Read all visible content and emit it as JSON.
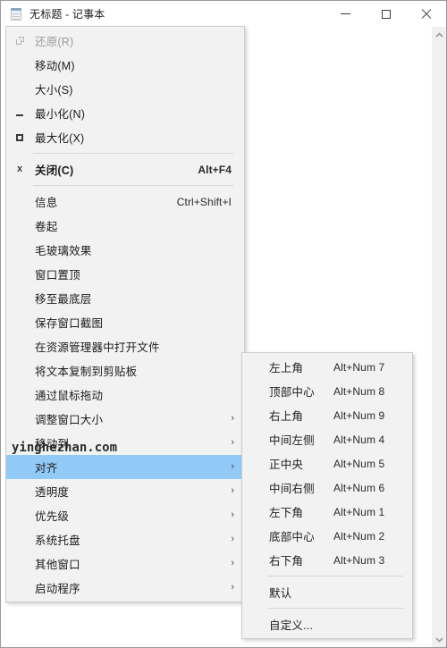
{
  "window": {
    "title": "无标题 - 记事本",
    "icon": "notepad-icon",
    "controls": {
      "minimize_label": "最小化",
      "maximize_label": "最大化",
      "close_label": "关闭"
    }
  },
  "system_menu": {
    "items": [
      {
        "label": "还原(R)",
        "accel": "",
        "icon": "restore-icon",
        "disabled": true,
        "bold": false,
        "submenu": false
      },
      {
        "label": "移动(M)",
        "accel": "",
        "icon": "",
        "disabled": false,
        "bold": false,
        "submenu": false
      },
      {
        "label": "大小(S)",
        "accel": "",
        "icon": "",
        "disabled": false,
        "bold": false,
        "submenu": false
      },
      {
        "label": "最小化(N)",
        "accel": "",
        "icon": "minimize-icon",
        "disabled": false,
        "bold": false,
        "submenu": false
      },
      {
        "label": "最大化(X)",
        "accel": "",
        "icon": "maximize-icon",
        "disabled": false,
        "bold": false,
        "submenu": false
      },
      {
        "separator": true
      },
      {
        "label": "关闭(C)",
        "accel": "Alt+F4",
        "icon": "close-icon",
        "disabled": false,
        "bold": true,
        "submenu": false
      },
      {
        "separator": true
      },
      {
        "label": "信息",
        "accel": "Ctrl+Shift+I",
        "icon": "",
        "disabled": false,
        "bold": false,
        "submenu": false
      },
      {
        "label": "卷起",
        "accel": "",
        "icon": "",
        "disabled": false,
        "bold": false,
        "submenu": false
      },
      {
        "label": "毛玻璃效果",
        "accel": "",
        "icon": "",
        "disabled": false,
        "bold": false,
        "submenu": false
      },
      {
        "label": "窗口置顶",
        "accel": "",
        "icon": "",
        "disabled": false,
        "bold": false,
        "submenu": false
      },
      {
        "label": "移至最底层",
        "accel": "",
        "icon": "",
        "disabled": false,
        "bold": false,
        "submenu": false
      },
      {
        "label": "保存窗口截图",
        "accel": "",
        "icon": "",
        "disabled": false,
        "bold": false,
        "submenu": false
      },
      {
        "label": "在资源管理器中打开文件",
        "accel": "",
        "icon": "",
        "disabled": false,
        "bold": false,
        "submenu": false
      },
      {
        "label": "将文本复制到剪贴板",
        "accel": "",
        "icon": "",
        "disabled": false,
        "bold": false,
        "submenu": false
      },
      {
        "label": "通过鼠标拖动",
        "accel": "",
        "icon": "",
        "disabled": false,
        "bold": false,
        "submenu": false
      },
      {
        "label": "调整窗口大小",
        "accel": "",
        "icon": "",
        "disabled": false,
        "bold": false,
        "submenu": true
      },
      {
        "label": "移动到",
        "accel": "",
        "icon": "",
        "disabled": false,
        "bold": false,
        "submenu": true
      },
      {
        "label": "对齐",
        "accel": "",
        "icon": "",
        "disabled": false,
        "bold": false,
        "submenu": true,
        "highlight": true
      },
      {
        "label": "透明度",
        "accel": "",
        "icon": "",
        "disabled": false,
        "bold": false,
        "submenu": true
      },
      {
        "label": "优先级",
        "accel": "",
        "icon": "",
        "disabled": false,
        "bold": false,
        "submenu": true
      },
      {
        "label": "系统托盘",
        "accel": "",
        "icon": "",
        "disabled": false,
        "bold": false,
        "submenu": true
      },
      {
        "label": "其他窗口",
        "accel": "",
        "icon": "",
        "disabled": false,
        "bold": false,
        "submenu": true
      },
      {
        "label": "启动程序",
        "accel": "",
        "icon": "",
        "disabled": false,
        "bold": false,
        "submenu": true
      }
    ]
  },
  "align_submenu": {
    "items": [
      {
        "label": "左上角",
        "accel": "Alt+Num 7"
      },
      {
        "label": "顶部中心",
        "accel": "Alt+Num 8"
      },
      {
        "label": "右上角",
        "accel": "Alt+Num 9"
      },
      {
        "label": "中间左侧",
        "accel": "Alt+Num 4"
      },
      {
        "label": "正中央",
        "accel": "Alt+Num 5"
      },
      {
        "label": "中间右侧",
        "accel": "Alt+Num 6"
      },
      {
        "label": "左下角",
        "accel": "Alt+Num 1"
      },
      {
        "label": "底部中心",
        "accel": "Alt+Num 2"
      },
      {
        "label": "右下角",
        "accel": "Alt+Num 3"
      },
      {
        "separator": true
      },
      {
        "label": "默认",
        "accel": ""
      },
      {
        "separator": true
      },
      {
        "label": "自定义...",
        "accel": ""
      }
    ]
  },
  "scrollbar": {
    "up_label": "向上滚动",
    "down_label": "向下滚动"
  },
  "watermark": {
    "text": "yinghezhan.com"
  },
  "colors": {
    "highlight": "#91c9f7",
    "menu_bg": "#f2f2f2",
    "menu_border": "#cdcdcd",
    "window_border": "#9a9a9a",
    "text": "#1b1b1b",
    "disabled_text": "#9c9c9c"
  }
}
